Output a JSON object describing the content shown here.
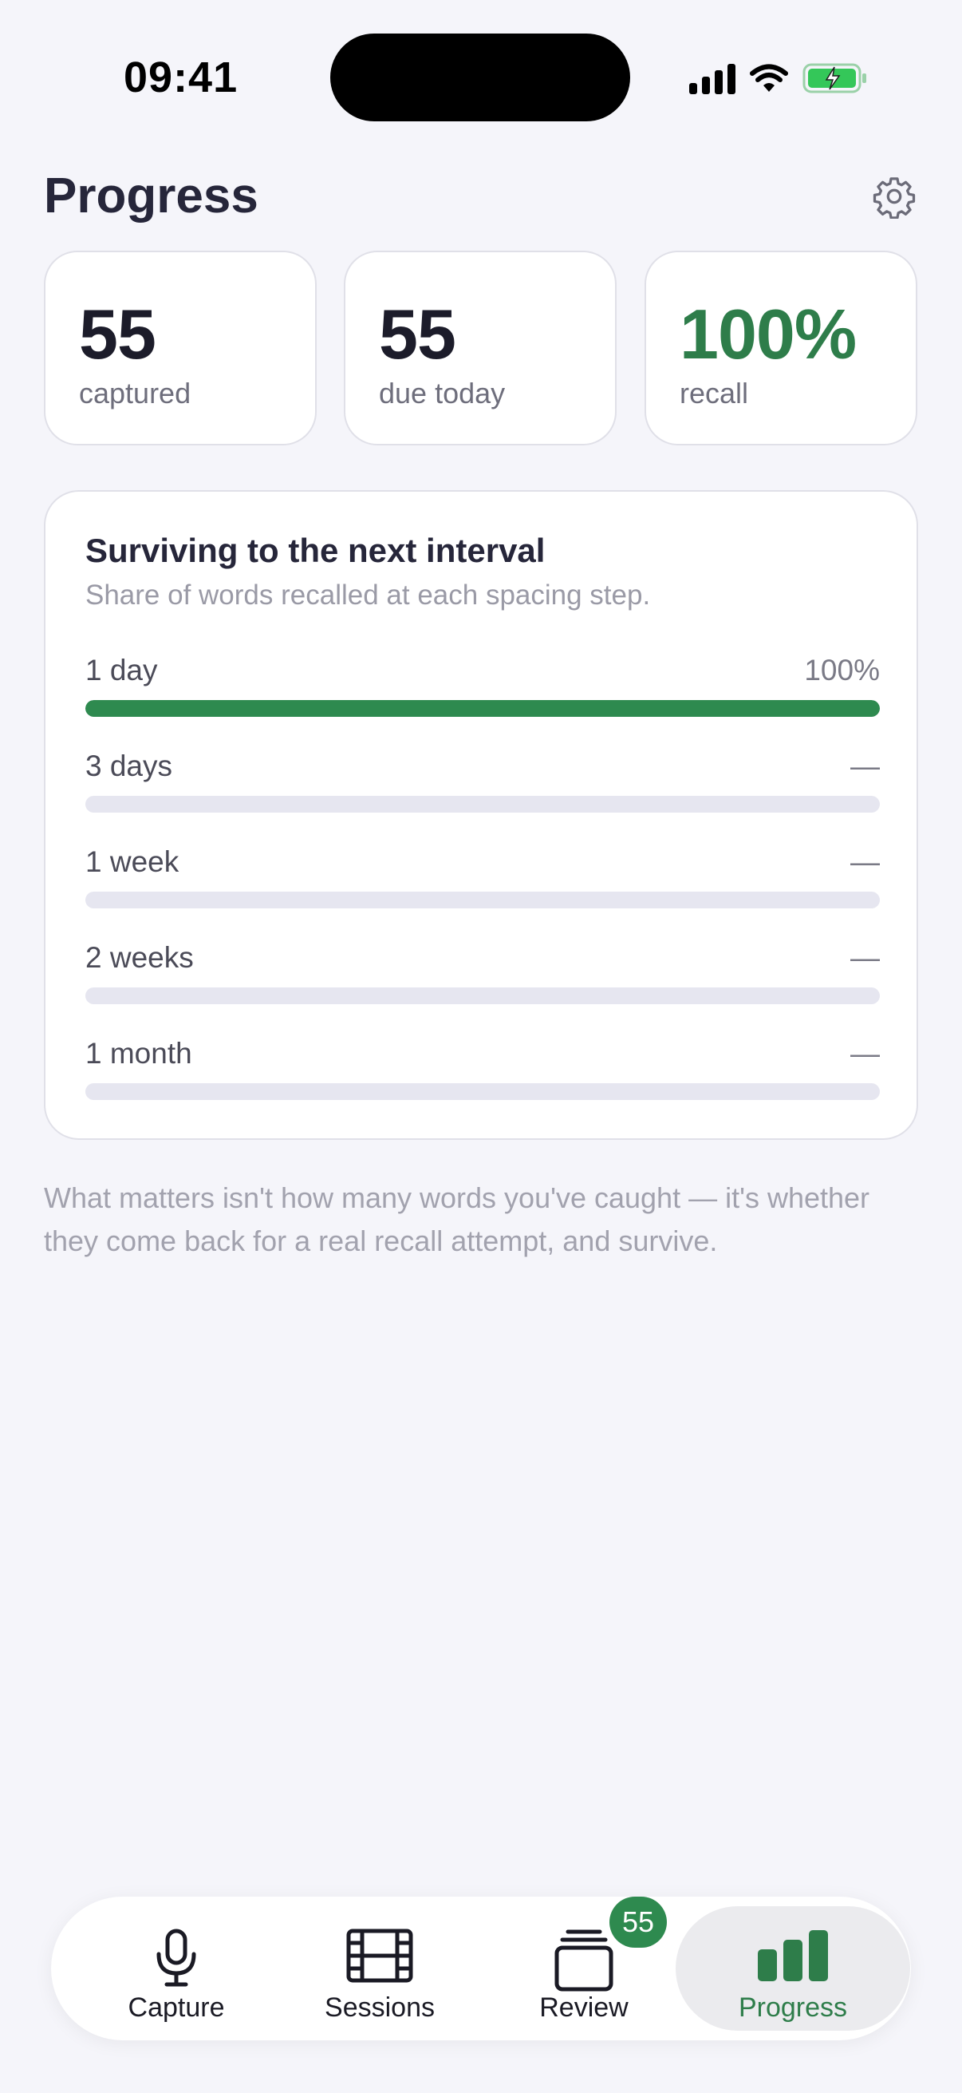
{
  "status_bar": {
    "time": "09:41"
  },
  "header": {
    "title": "Progress",
    "settings_icon": "gear-icon"
  },
  "stats": [
    {
      "value": "55",
      "label": "captured"
    },
    {
      "value": "55",
      "label": "due today"
    },
    {
      "value": "100%",
      "label": "recall",
      "accent": "#2e7d4a"
    }
  ],
  "survival": {
    "title": "Surviving to the next interval",
    "subtitle": "Share of words recalled at each spacing step.",
    "intervals": [
      {
        "label": "1 day",
        "value": "100%",
        "fill": 1.0
      },
      {
        "label": "3 days",
        "value": "—",
        "fill": 0
      },
      {
        "label": "1 week",
        "value": "—",
        "fill": 0
      },
      {
        "label": "2 weeks",
        "value": "—",
        "fill": 0
      },
      {
        "label": "1 month",
        "value": "—",
        "fill": 0
      }
    ]
  },
  "footnote": "What matters isn't how many words you've caught — it's whether they come back for a real recall attempt, and survive.",
  "tabs": [
    {
      "label": "Capture",
      "icon": "microphone-icon"
    },
    {
      "label": "Sessions",
      "icon": "film-icon"
    },
    {
      "label": "Review",
      "icon": "cards-icon",
      "badge": "55"
    },
    {
      "label": "Progress",
      "icon": "bar-chart-icon",
      "active": true
    }
  ],
  "colors": {
    "accent": "#2e8a4f",
    "background": "#f5f5fa",
    "track": "#e6e6f0"
  }
}
